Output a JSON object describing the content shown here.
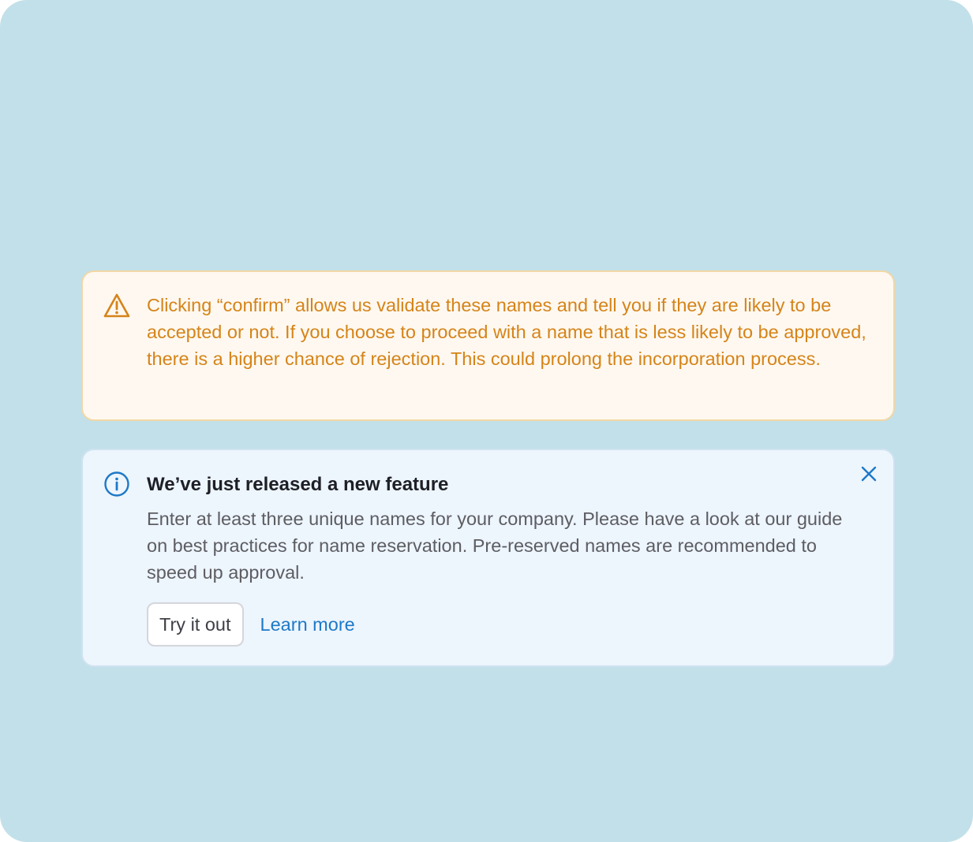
{
  "colors": {
    "page_background": "#c2e0e9",
    "warning_text": "#d58419",
    "warning_background": "#fef8f0",
    "warning_border": "#f1d7a6",
    "info_background": "#edf5fd",
    "info_border": "#cfe2f1",
    "info_accent": "#1d79c7"
  },
  "warning_alert": {
    "icon": "warning-triangle-icon",
    "message": "Clicking “confirm” allows us validate these names and tell you if they are likely to be accepted or not. If you choose to proceed with a name that is less likely to be approved, there is a higher chance of rejection. This could prolong the incorporation process."
  },
  "info_alert": {
    "icon": "info-circle-icon",
    "title": "We’ve just released a new feature",
    "body": "Enter at least three unique names for your company. Please have a look at our guide on best practices for name reservation. Pre-reserved names are recommended to speed up approval.",
    "primary_action_label": "Try it out",
    "secondary_action_label": "Learn more",
    "close_icon": "close-icon"
  }
}
